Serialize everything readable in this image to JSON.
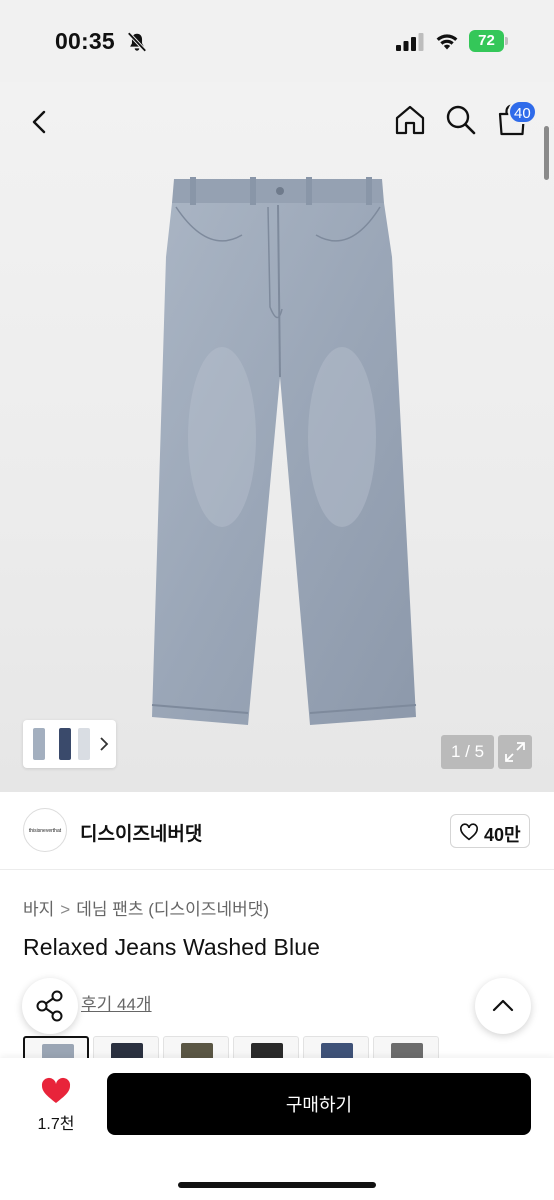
{
  "status_bar": {
    "time": "00:35",
    "battery": "72"
  },
  "nav": {
    "cart_count": "40"
  },
  "gallery": {
    "page_indicator": "1 / 5"
  },
  "brand": {
    "logo_text": "thisisneverthat",
    "name": "디스이즈네버댓",
    "like_count": "40만"
  },
  "breadcrumb": {
    "category": "바지",
    "separator": ">",
    "subcategory": "데님 팬츠 (디스이즈네버댓)"
  },
  "product": {
    "title": "Relaxed Jeans Washed Blue",
    "reviews_link": "후기 44개",
    "swatch_colors": [
      "#9aa5b4",
      "#2b3140",
      "#5a5644",
      "#2a2a2a",
      "#3f5278",
      "#6c6c6c"
    ]
  },
  "bottom_bar": {
    "wishlist_count": "1.7천",
    "buy_label": "구매하기"
  },
  "colors": {
    "accent": "#2f6bea",
    "battery": "#34c759",
    "wishlist_heart": "#e8243a",
    "denim": "#a3afbf"
  }
}
